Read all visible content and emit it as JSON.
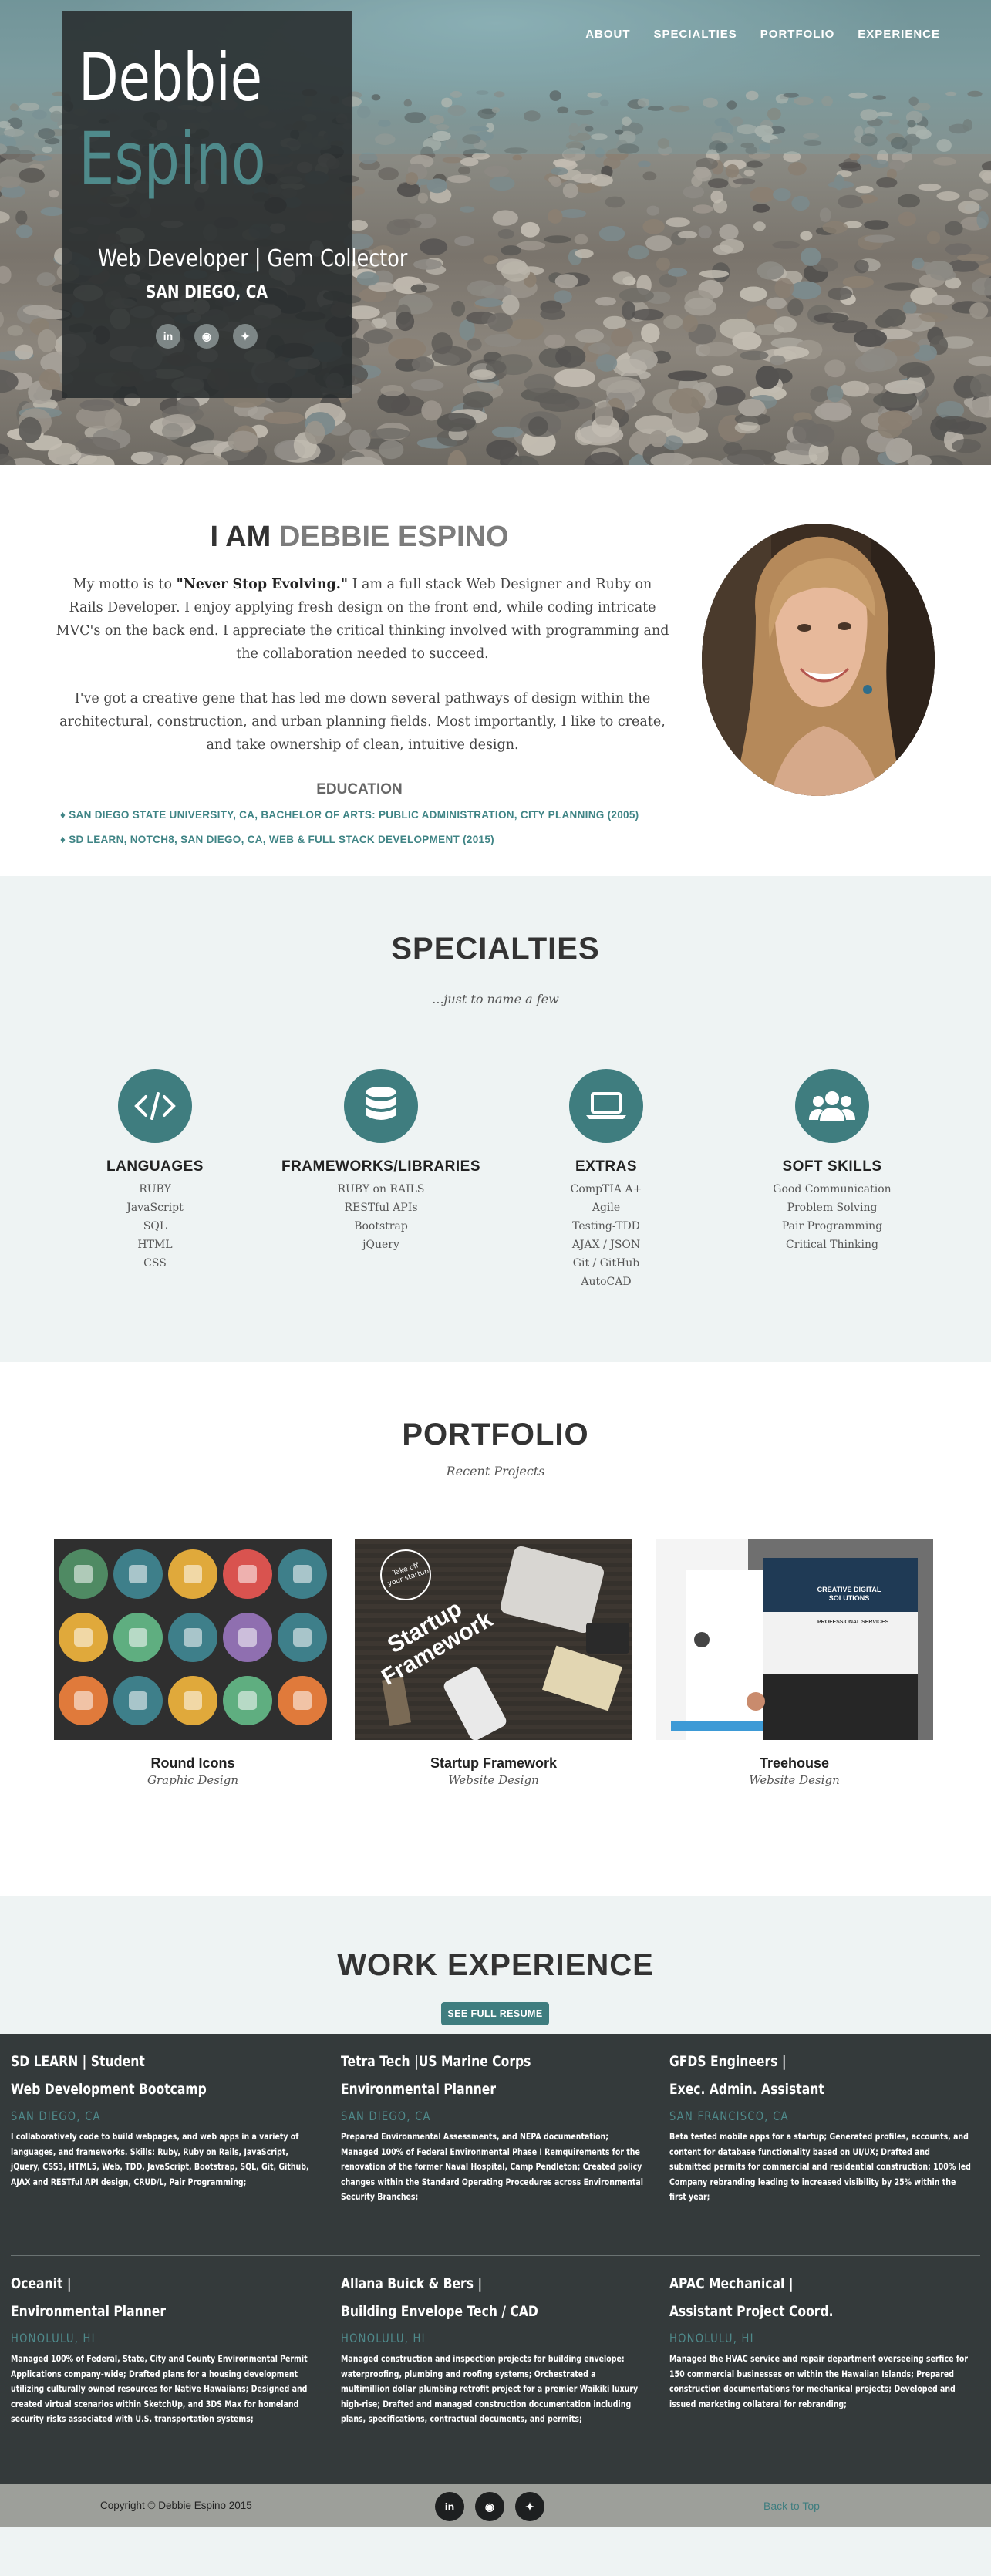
{
  "nav": {
    "items": [
      {
        "label": "ABOUT"
      },
      {
        "label": "SPECIALTIES"
      },
      {
        "label": "PORTFOLIO"
      },
      {
        "label": "EXPERIENCE"
      }
    ]
  },
  "hero": {
    "first_name": "Debbie",
    "last_name": "Espino",
    "tagline": "Web Developer | Gem Collector",
    "location": "SAN DIEGO, CA",
    "social": [
      {
        "icon": "linkedin-icon",
        "glyph": "in"
      },
      {
        "icon": "github-icon",
        "glyph": "◉"
      },
      {
        "icon": "twitter-icon",
        "glyph": "✦"
      }
    ]
  },
  "about": {
    "heading_prefix": "I AM ",
    "heading_name": "DEBBIE ESPINO",
    "p1_before": "My motto is to ",
    "p1_bold": "\"Never Stop Evolving.\"",
    "p1_after": " I am a full stack Web Designer and Ruby on Rails Developer. I enjoy applying fresh design on the front end, while coding intricate MVC's on the back end. I appreciate the critical thinking involved with programming and the collaboration needed to succeed.",
    "p2": "I've got a creative gene that has led me down several pathways of design within the architectural, construction, and urban planning fields. Most importantly, I like to create, and take ownership of clean, intuitive design.",
    "education_heading": "EDUCATION",
    "education": [
      "♦ SAN DIEGO STATE UNIVERSITY, CA, BACHELOR OF ARTS: PUBLIC ADMINISTRATION, CITY PLANNING (2005)",
      "♦ SD LEARN, NOTCH8, SAN DIEGO, CA, WEB & FULL STACK DEVELOPMENT (2015)"
    ]
  },
  "specialties": {
    "title": "SPECIALTIES",
    "subtitle": "...just to name a few",
    "columns": [
      {
        "icon": "code-icon",
        "title": "LANGUAGES",
        "items": [
          "RUBY",
          "JavaScript",
          "SQL",
          "HTML",
          "CSS"
        ]
      },
      {
        "icon": "database-icon",
        "title": "FRAMEWORKS/LIBRARIES",
        "items": [
          "RUBY on RAILS",
          "RESTful APIs",
          "Bootstrap",
          "jQuery"
        ]
      },
      {
        "icon": "laptop-icon",
        "title": "EXTRAS",
        "items": [
          "CompTIA A+",
          "Agile",
          "Testing-TDD",
          "AJAX / JSON",
          "Git / GitHub",
          "AutoCAD"
        ]
      },
      {
        "icon": "users-icon",
        "title": "SOFT SKILLS",
        "items": [
          "Good Communication",
          "Problem Solving",
          "Pair Programming",
          "Critical Thinking"
        ]
      }
    ]
  },
  "portfolio": {
    "title": "PORTFOLIO",
    "subtitle": "Recent Projects",
    "items": [
      {
        "title": "Round Icons",
        "category": "Graphic Design"
      },
      {
        "title": "Startup Framework",
        "category": "Website Design",
        "thumb_text": "Startup Framework",
        "thumb_badge": "Take off your startup"
      },
      {
        "title": "Treehouse",
        "category": "Website Design",
        "thumb_text": "CREATIVE DIGITAL SOLUTIONS",
        "thumb_sub": "PROFESSIONAL SERVICES"
      }
    ]
  },
  "work": {
    "title": "WORK EXPERIENCE",
    "resume_button": "SEE FULL RESUME",
    "jobs": [
      {
        "company": "SD LEARN | Student",
        "role": "Web Development Bootcamp",
        "location": "SAN DIEGO, CA",
        "desc": "I collaboratively code to build webpages, and web apps in a variety of languages, and frameworks. Skills: Ruby, Ruby on Rails, JavaScript, jQuery, CSS3, HTML5, Web, TDD, JavaScript, Bootstrap, SQL, Git, Github, AJAX and RESTful API design, CRUD/L, Pair Programming;"
      },
      {
        "company": "Tetra Tech |US Marine Corps",
        "role": "Environmental Planner",
        "location": "SAN DIEGO, CA",
        "desc": "Prepared Environmental Assessments, and NEPA documentation; Managed 100% of Federal Environmental Phase I Remquirements for the renovation of the former Naval Hospital, Camp Pendleton; Created policy changes within the Standard Operating Procedures across Environmental Security Branches;"
      },
      {
        "company": "GFDS Engineers |",
        "role": "Exec. Admin. Assistant",
        "location": "SAN FRANCISCO, CA",
        "desc": "Beta tested mobile apps for a startup; Generated profiles, accounts, and content for database functionality based on UI/UX; Drafted and submitted permits for commercial and residential construction; 100% led Company rebranding leading to increased visibility by 25% within the first year;"
      },
      {
        "company": "Oceanit |",
        "role": "Environmental Planner",
        "location": "HONOLULU, HI",
        "desc": "Managed 100% of Federal, State, City and County Environmental Permit Applications company-wide; Drafted plans for a housing development utilizing culturally owned resources for Native Hawaiians; Designed and created virtual scenarios within SketchUp, and 3DS Max for homeland security risks associated with U.S. transportation systems;"
      },
      {
        "company": "Allana Buick & Bers |",
        "role": "Building Envelope Tech / CAD",
        "location": "HONOLULU, HI",
        "desc": "Managed construction and inspection projects for building envelope: waterproofing, plumbing and roofing systems; Orchestrated a multimillion dollar plumbing retrofit project for a premier Waikiki luxury high-rise; Drafted and managed construction documentation including plans, specifications, contractual documents, and permits;"
      },
      {
        "company": "APAC Mechanical |",
        "role": "Assistant Project Coord.",
        "location": "HONOLULU, HI",
        "desc": "Managed the HVAC service and repair department overseeing serfice for 150 commercial businesses on within the Hawaiian Islands; Prepared construction documentations for mechanical projects; Developed and issued marketing collateral for rebranding;"
      }
    ]
  },
  "footer": {
    "copyright": "Copyright © Debbie Espino 2015",
    "social": [
      {
        "icon": "linkedin-icon",
        "glyph": "in"
      },
      {
        "icon": "github-icon",
        "glyph": "◉"
      },
      {
        "icon": "twitter-icon",
        "glyph": "✦"
      }
    ],
    "back_to_top": "Back to Top"
  },
  "colors": {
    "accent": "#3f7d7f",
    "dark_panel": "#343a3b",
    "light_bg": "#eef3f3"
  }
}
